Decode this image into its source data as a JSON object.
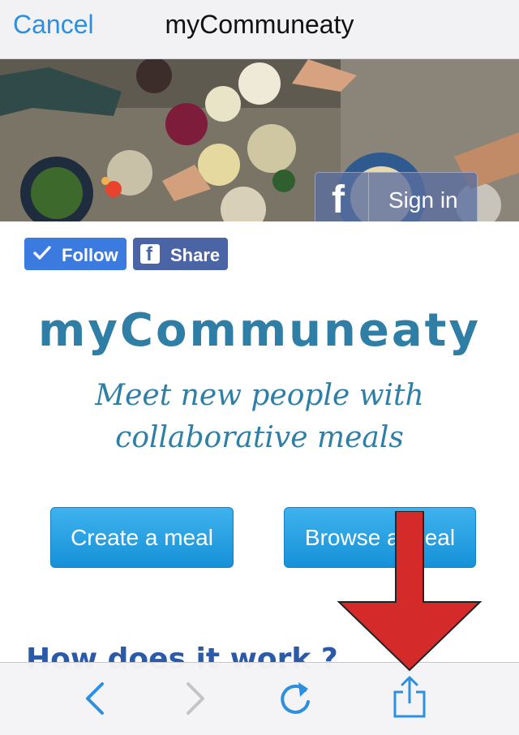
{
  "nav": {
    "cancel_label": "Cancel",
    "title": "myCommuneaty"
  },
  "hero": {
    "signin_label": "Sign in",
    "signin_icon": "facebook-f-icon"
  },
  "social": {
    "follow_label": "Follow",
    "share_label": "Share"
  },
  "content": {
    "brand": "myCommuneaty",
    "tagline_line1": "Meet new people with",
    "tagline_line2": "collaborative meals",
    "create_label": "Create a meal",
    "browse_label": "Browse a meal",
    "how_heading": "How does it work ?"
  },
  "toolbar": {
    "icons": [
      "back-chevron-icon",
      "forward-chevron-icon",
      "reload-icon",
      "share-icon"
    ]
  },
  "colors": {
    "accent": "#2d8fe0",
    "brand": "#2f7ea6",
    "arrow": "#d42a2a",
    "action_button": "#1e9ee2",
    "follow_button": "#3b7be0",
    "share_button": "#4a64a6"
  }
}
